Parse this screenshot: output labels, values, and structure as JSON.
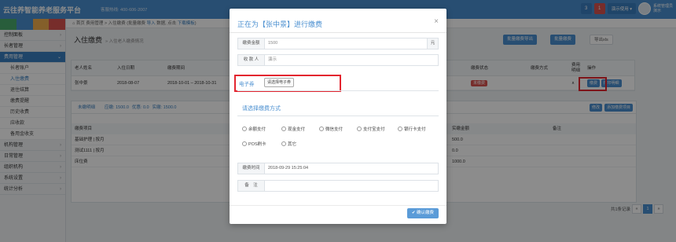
{
  "topbar": {
    "logo": "云往养智能养老服务平台",
    "hotline": "客服热线: 400-606-2007",
    "badge_user": "3",
    "badge_bell": "1",
    "demo_button": "演示使用 ▾",
    "user_name": "系统管理员",
    "user_role": "演示"
  },
  "sidebar": {
    "items": [
      {
        "label": "控制面板"
      },
      {
        "label": "长者管理"
      },
      {
        "label": "费用管理"
      },
      {
        "label": "机构管理"
      },
      {
        "label": "日常管理"
      },
      {
        "label": "组织机构"
      },
      {
        "label": "系统设置"
      },
      {
        "label": "统计分析"
      }
    ],
    "subitems": [
      "长者账户",
      "入住缴费",
      "退住结算",
      "缴费提醒",
      "历史收费",
      "应收款",
      "备用金收支"
    ]
  },
  "main": {
    "breadcrumb_home": "首页",
    "breadcrumb_rest": "费用管理 > 入住缴费 (批量缴费",
    "breadcrumb_import": "导入",
    "breadcrumb_tail": "数据, 点击",
    "breadcrumb_template": "下载模板",
    "breadcrumb_end": ")",
    "page_title": "入住缴费",
    "page_subtitle": "» 入住老人缴费情况",
    "btn_bulk": "批量缴费导出",
    "btn_print": "批量缴费",
    "btn_export": "导出xls",
    "table_headers": [
      "老人姓名",
      "入住日期",
      "缴费期间",
      "缴费状态",
      "缴费方式",
      "费用明细",
      "操作"
    ],
    "row": {
      "name": "张中景",
      "date": "2018-08-07",
      "period": "2018-10-01 – 2018-10-31",
      "status": "未缴费",
      "btn_pay": "缴费",
      "btn_detail": "打印明细"
    },
    "detail": {
      "tab": "未缴明细",
      "summary_should": "应缴: 1500.0",
      "summary_discount": "优惠: 0.0",
      "summary_paid": "实缴: 1500.0",
      "btn_modify": "修改",
      "btn_add": "添加缴费项目",
      "headers": [
        "缴费项目",
        "实缴金额",
        "备注"
      ],
      "rows": [
        {
          "item": "基础护理 | 按月",
          "amount": "500.0"
        },
        {
          "item": "测试1111 | 按月",
          "amount": "0.0"
        },
        {
          "item": "床位费",
          "amount": "1000.0"
        }
      ]
    },
    "pager_text": "共1条记录",
    "pager_prev": "«",
    "pager_page": "1",
    "pager_next": "»"
  },
  "modal": {
    "title": "正在为【张中景】进行缴费",
    "close": "×",
    "amount_label": "缴费金额",
    "amount_value": "1500",
    "amount_unit": "元",
    "payer_label": "收 款 人",
    "payer_value": "演示",
    "coupon_label": "电子券",
    "coupon_button": "请选择电子券",
    "pay_method_title": "请选择缴费方式",
    "methods": [
      "余额支付",
      "现金支付",
      "微信支付",
      "支付宝支付",
      "银行卡支付",
      "POS刷卡",
      "其它"
    ],
    "time_label": "缴费时间",
    "time_value": "2018-09-29 15:25:04",
    "remark_label": "备　注",
    "confirm": "确认缴费"
  },
  "colors": {
    "primary": "#4a8fd0",
    "highlight": "#e3252f",
    "danger": "#d9534f"
  }
}
